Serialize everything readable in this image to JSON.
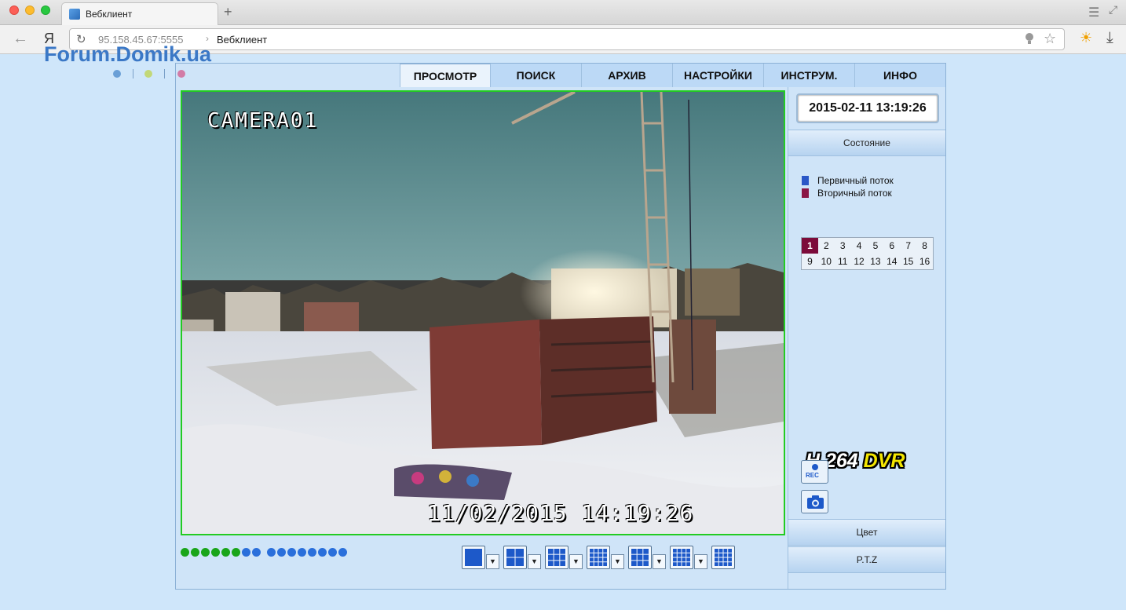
{
  "browser": {
    "tab_title": "Вебклиент",
    "new_tab": "+",
    "address_host": "95.158.45.67:5555",
    "address_separator": "›",
    "address_title": "Вебклиент",
    "yandex_letter": "Я"
  },
  "watermark": {
    "text": "Forum.Domik.ua",
    "dot_colors": [
      "#6a9fd6",
      "#c2d878",
      "#d27ba6"
    ]
  },
  "nav": {
    "tabs": [
      {
        "label": "ПРОСМОТР",
        "active": true
      },
      {
        "label": "ПОИСК",
        "active": false
      },
      {
        "label": "АРХИВ",
        "active": false
      },
      {
        "label": "НАСТРОЙКИ",
        "active": false
      },
      {
        "label": "ИНСТРУМ.",
        "active": false
      },
      {
        "label": "ИНФО",
        "active": false
      }
    ]
  },
  "video": {
    "camera_label": "CAMERA01",
    "timestamp": "11/02/2015 14:19:26",
    "border_color": "#22cc22"
  },
  "status_dots": {
    "group1": [
      "#1aa51a",
      "#1aa51a",
      "#1aa51a",
      "#1aa51a",
      "#1aa51a",
      "#1aa51a",
      "#2a6fdb",
      "#2a6fdb"
    ],
    "group2": [
      "#2a6fdb",
      "#2a6fdb",
      "#2a6fdb",
      "#2a6fdb",
      "#2a6fdb",
      "#2a6fdb",
      "#2a6fdb",
      "#2a6fdb"
    ]
  },
  "layouts": {
    "buttons": [
      {
        "name": "layout-1-button",
        "grid": 1,
        "dropdown": true
      },
      {
        "name": "layout-4-button",
        "grid": 2,
        "dropdown": true
      },
      {
        "name": "layout-6-button",
        "grid": 3,
        "dropdown": true
      },
      {
        "name": "layout-8-button",
        "grid": 4,
        "dropdown": true
      },
      {
        "name": "layout-9-button",
        "grid": 3,
        "dropdown": true
      },
      {
        "name": "layout-16-button",
        "grid": 4,
        "dropdown": true
      },
      {
        "name": "layout-full-button",
        "grid": 4,
        "dropdown": false
      }
    ],
    "dropdown_glyph": "▼",
    "icon_color": "#1d59c9"
  },
  "side": {
    "datetime": "2015-02-11 13:19:26",
    "state_label": "Состояние",
    "legend": [
      {
        "label": "Первичный поток",
        "color": "#2a57c7"
      },
      {
        "label": "Вторичный поток",
        "color": "#8a1545"
      }
    ],
    "channels": [
      "1",
      "2",
      "3",
      "4",
      "5",
      "6",
      "7",
      "8",
      "9",
      "10",
      "11",
      "12",
      "13",
      "14",
      "15",
      "16"
    ],
    "active_channel": "1",
    "logo_h264": "H.264",
    "logo_dvr": "DVR",
    "rec_label": "REC",
    "color_label": "Цвет",
    "ptz_label": "P.T.Z"
  }
}
